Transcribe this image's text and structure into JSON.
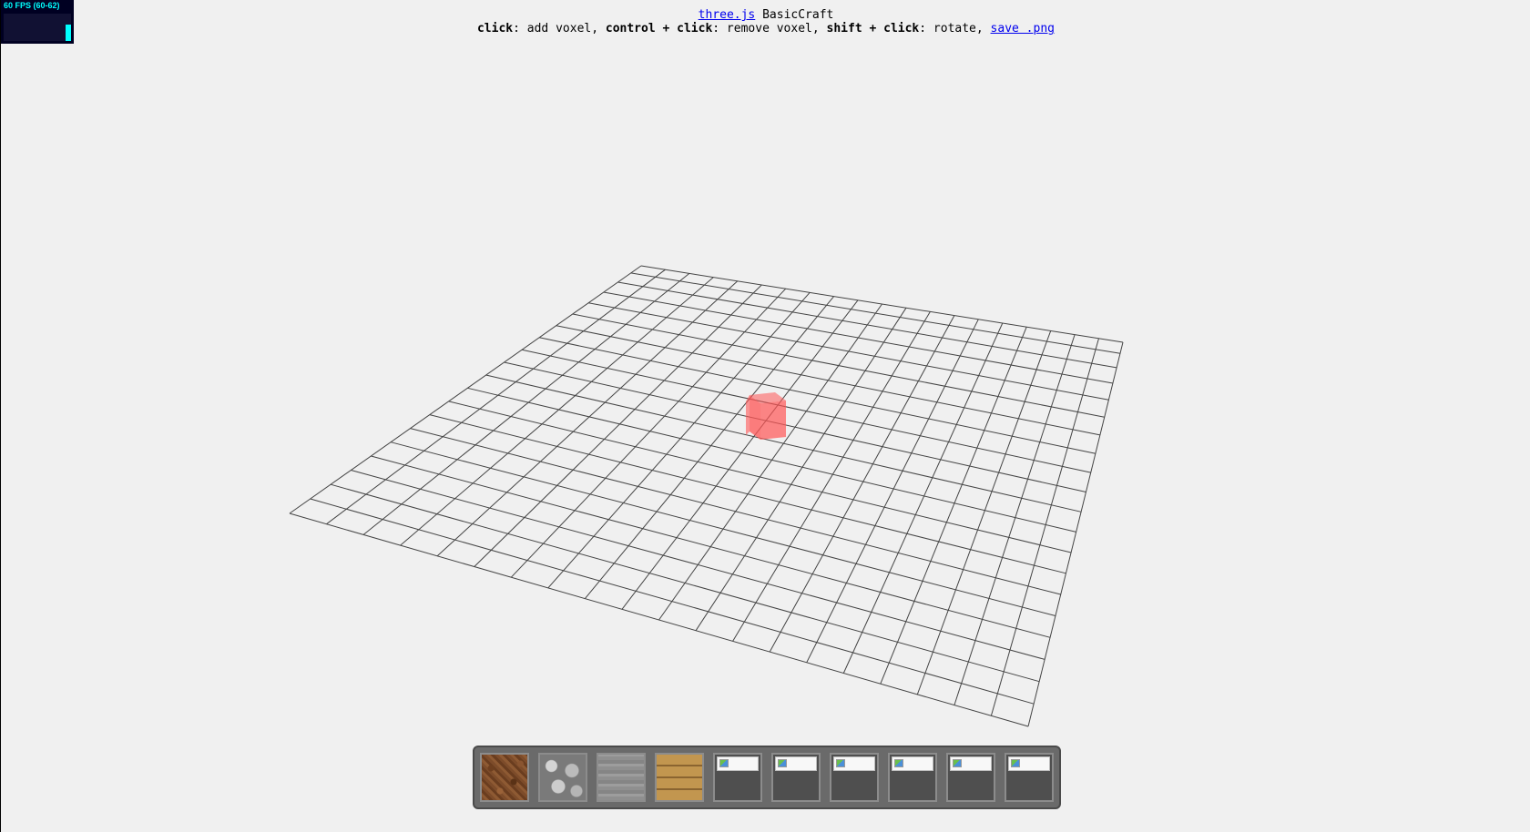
{
  "stats": {
    "fps_text": "60 FPS (60-62)",
    "fps_value": 60,
    "fps_min": 60,
    "fps_max": 62
  },
  "info": {
    "link_threejs": "three.js",
    "app_name": " BasicCraft",
    "instr_click": "click",
    "instr_click_desc": ": add voxel, ",
    "instr_control": "control + click",
    "instr_control_desc": ": remove voxel, ",
    "instr_shift": "shift + click",
    "instr_shift_desc": ": rotate, ",
    "link_save": "save .png"
  },
  "scene": {
    "grid_divisions": 20,
    "grid_color": "#444444",
    "cursor_voxel_color": "#ff5555",
    "background": "#f0f0f0"
  },
  "hotbar": {
    "slots": [
      {
        "texture": "dirt",
        "empty": false
      },
      {
        "texture": "cobblestone",
        "empty": false
      },
      {
        "texture": "stone-brick",
        "empty": false
      },
      {
        "texture": "wood-plank",
        "empty": false
      },
      {
        "texture": "broken-image",
        "empty": true
      },
      {
        "texture": "broken-image",
        "empty": true
      },
      {
        "texture": "broken-image",
        "empty": true
      },
      {
        "texture": "broken-image",
        "empty": true
      },
      {
        "texture": "broken-image",
        "empty": true
      },
      {
        "texture": "broken-image",
        "empty": true
      }
    ]
  }
}
